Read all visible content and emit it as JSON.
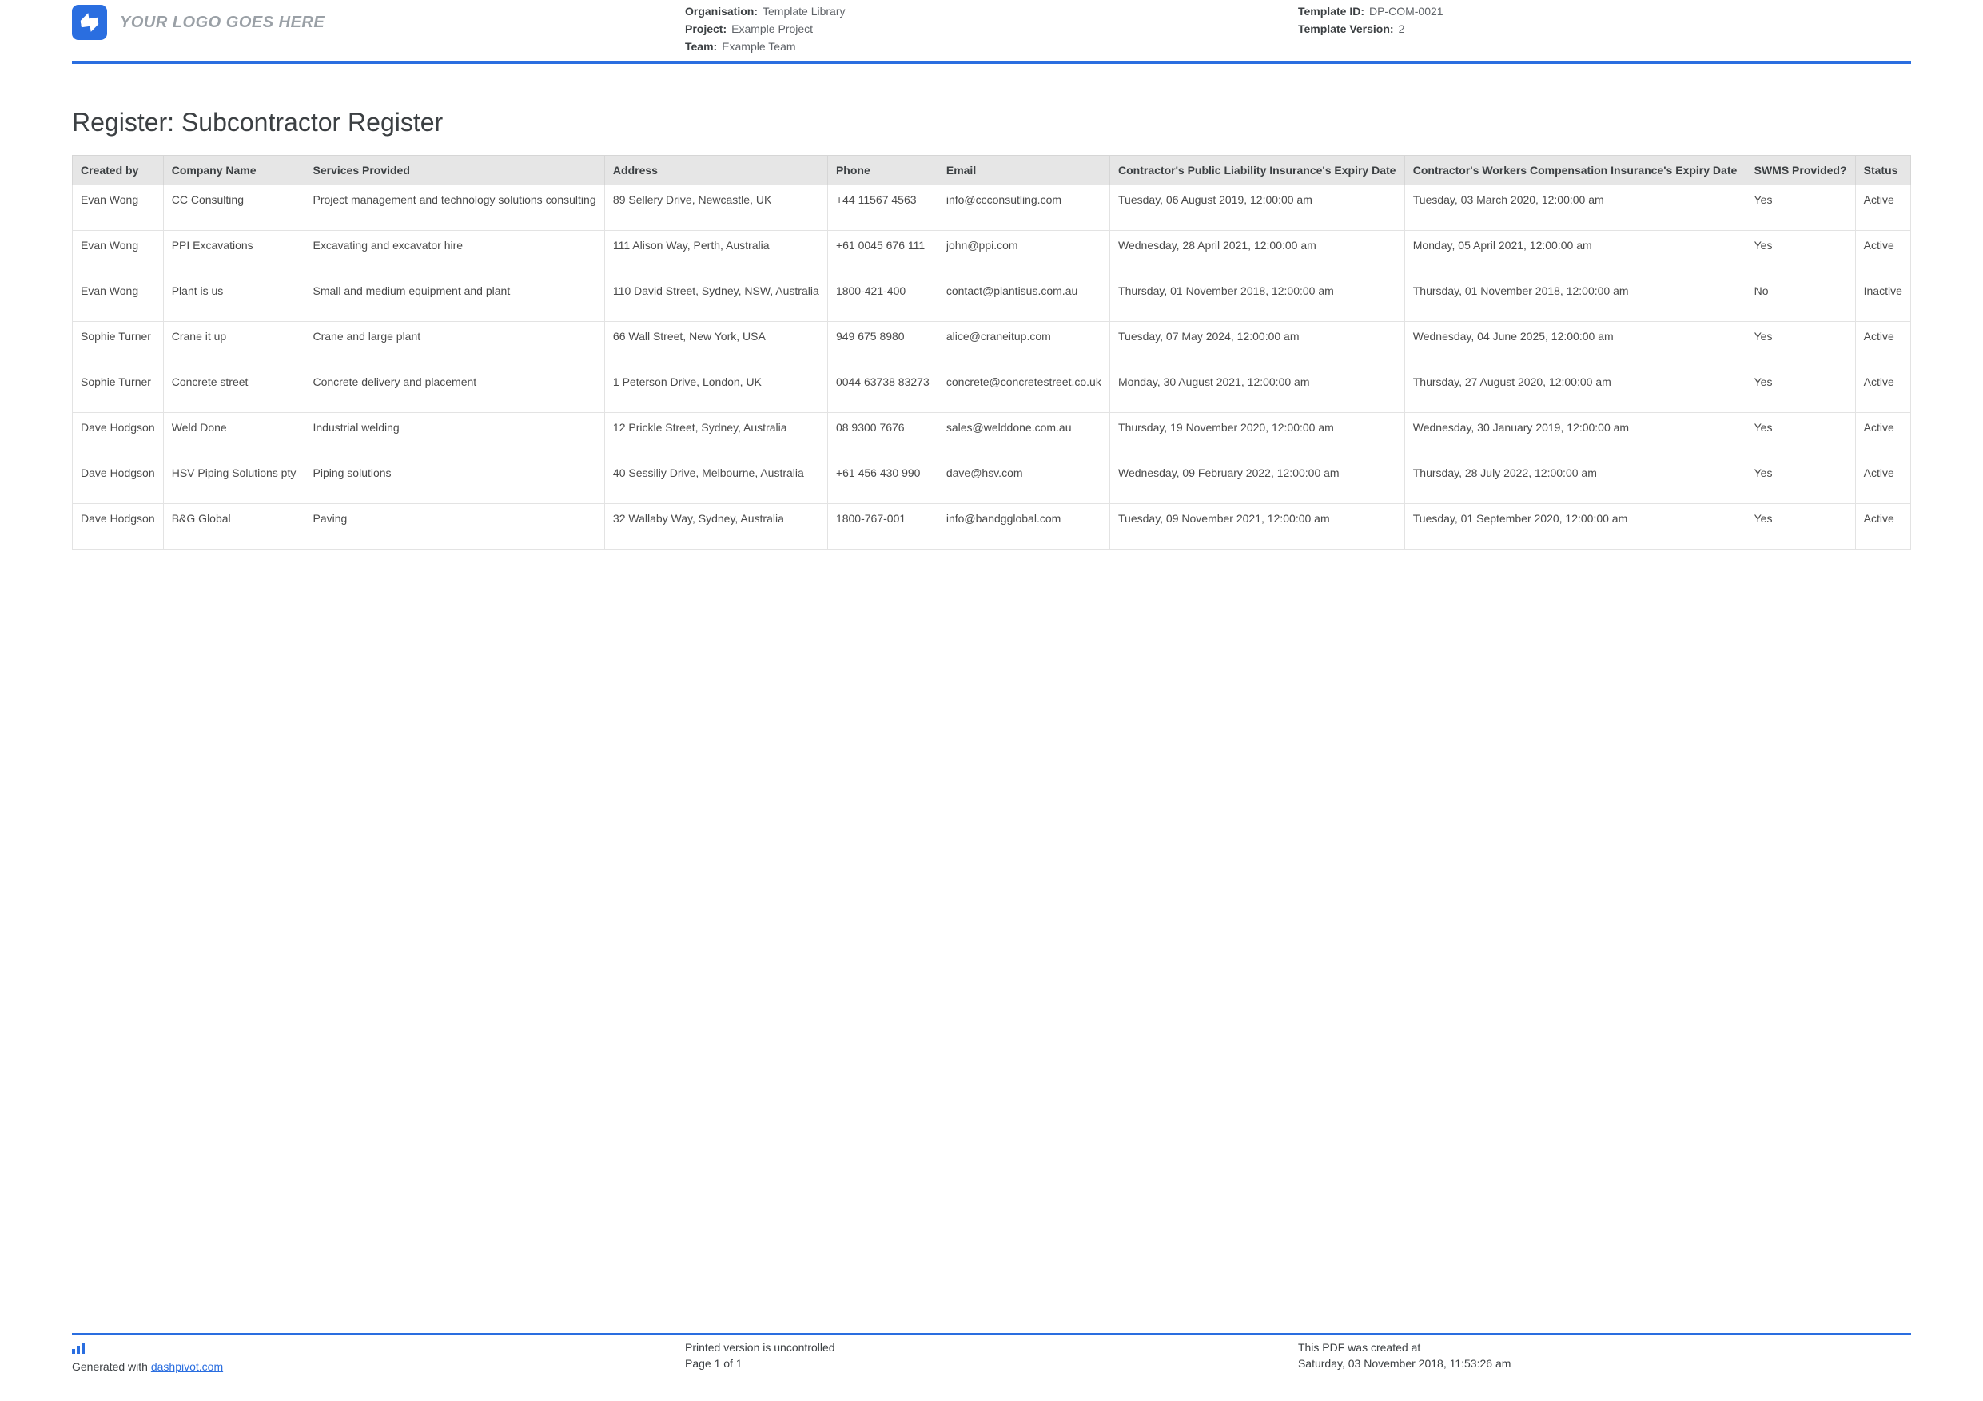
{
  "header": {
    "logo_text": "YOUR LOGO GOES HERE",
    "col1": {
      "org_label": "Organisation:",
      "org_value": "Template Library",
      "project_label": "Project:",
      "project_value": "Example Project",
      "team_label": "Team:",
      "team_value": "Example Team"
    },
    "col2": {
      "template_id_label": "Template ID:",
      "template_id_value": "DP-COM-0021",
      "template_version_label": "Template Version:",
      "template_version_value": "2"
    }
  },
  "title": "Register: Subcontractor Register",
  "columns": [
    "Created by",
    "Company Name",
    "Services Provided",
    "Address",
    "Phone",
    "Email",
    "Contractor's Public Liability Insurance's Expiry Date",
    "Contractor's Workers Compensation Insurance's Expiry Date",
    "SWMS Provided?",
    "Status"
  ],
  "rows": [
    {
      "created_by": "Evan Wong",
      "company": "CC Consulting",
      "services": "Project management and technology solutions consulting",
      "address": "89 Sellery Drive, Newcastle, UK",
      "phone": "+44 11567 4563",
      "email": "info@ccconsutling.com",
      "liability": "Tuesday, 06 August 2019, 12:00:00 am",
      "workers": "Tuesday, 03 March 2020, 12:00:00 am",
      "swms": "Yes",
      "status": "Active"
    },
    {
      "created_by": "Evan Wong",
      "company": "PPI Excavations",
      "services": "Excavating and excavator hire",
      "address": "111 Alison Way, Perth, Australia",
      "phone": "+61 0045 676 111",
      "email": "john@ppi.com",
      "liability": "Wednesday, 28 April 2021, 12:00:00 am",
      "workers": "Monday, 05 April 2021, 12:00:00 am",
      "swms": "Yes",
      "status": "Active"
    },
    {
      "created_by": "Evan Wong",
      "company": "Plant is us",
      "services": "Small and medium equipment and plant",
      "address": "110 David Street, Sydney, NSW, Australia",
      "phone": "1800-421-400",
      "email": "contact@plantisus.com.au",
      "liability": "Thursday, 01 November 2018, 12:00:00 am",
      "workers": "Thursday, 01 November 2018, 12:00:00 am",
      "swms": "No",
      "status": "Inactive"
    },
    {
      "created_by": "Sophie Turner",
      "company": "Crane it up",
      "services": "Crane and large plant",
      "address": "66 Wall Street, New York, USA",
      "phone": "949 675 8980",
      "email": "alice@craneitup.com",
      "liability": "Tuesday, 07 May 2024, 12:00:00 am",
      "workers": "Wednesday, 04 June 2025, 12:00:00 am",
      "swms": "Yes",
      "status": "Active"
    },
    {
      "created_by": "Sophie Turner",
      "company": "Concrete street",
      "services": "Concrete delivery and placement",
      "address": "1 Peterson Drive, London, UK",
      "phone": "0044 63738 83273",
      "email": "concrete@concretestreet.co.uk",
      "liability": "Monday, 30 August 2021, 12:00:00 am",
      "workers": "Thursday, 27 August 2020, 12:00:00 am",
      "swms": "Yes",
      "status": "Active"
    },
    {
      "created_by": "Dave Hodgson",
      "company": "Weld Done",
      "services": "Industrial welding",
      "address": "12 Prickle Street, Sydney, Australia",
      "phone": "08 9300 7676",
      "email": "sales@welddone.com.au",
      "liability": "Thursday, 19 November 2020, 12:00:00 am",
      "workers": "Wednesday, 30 January 2019, 12:00:00 am",
      "swms": "Yes",
      "status": "Active"
    },
    {
      "created_by": "Dave Hodgson",
      "company": "HSV Piping Solutions pty",
      "services": "Piping solutions",
      "address": "40 Sessiliy Drive, Melbourne, Australia",
      "phone": "+61 456 430 990",
      "email": "dave@hsv.com",
      "liability": "Wednesday, 09 February 2022, 12:00:00 am",
      "workers": "Thursday, 28 July 2022, 12:00:00 am",
      "swms": "Yes",
      "status": "Active"
    },
    {
      "created_by": "Dave Hodgson",
      "company": "B&G Global",
      "services": "Paving",
      "address": "32 Wallaby Way, Sydney, Australia",
      "phone": "1800-767-001",
      "email": "info@bandgglobal.com",
      "liability": "Tuesday, 09 November 2021, 12:00:00 am",
      "workers": "Tuesday, 01 September 2020, 12:00:00 am",
      "swms": "Yes",
      "status": "Active"
    }
  ],
  "footer": {
    "generated_prefix": "Generated with ",
    "generated_link": "dashpivot.com",
    "uncontrolled": "Printed version is uncontrolled",
    "page": "Page 1 of 1",
    "created_label": "This PDF was created at",
    "created_value": "Saturday, 03 November 2018, 11:53:26 am"
  }
}
